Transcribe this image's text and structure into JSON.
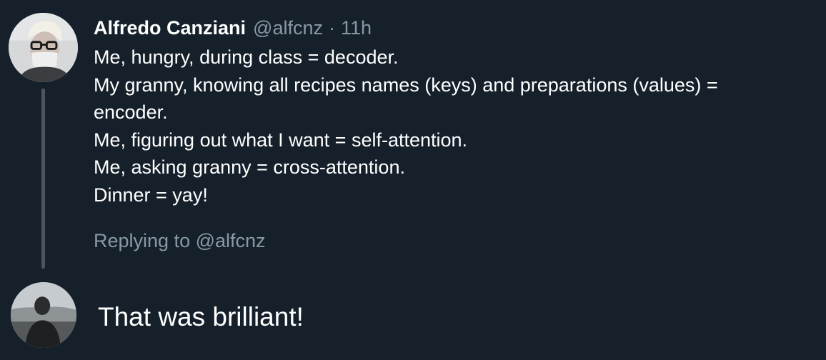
{
  "original_tweet": {
    "author_name": "Alfredo Canziani",
    "author_handle": "@alfcnz",
    "separator": "·",
    "timestamp": "11h",
    "lines": [
      "Me, hungry, during class = decoder.",
      "My granny, knowing all recipes names (keys) and preparations (values) =",
      "encoder.",
      "Me, figuring out what I want = self-attention.",
      "Me, asking granny = cross-attention.",
      "Dinner = yay!"
    ]
  },
  "reply_composer": {
    "replying_label": "Replying to",
    "replying_handle": "@alfcnz",
    "reply_text": "That was brilliant!"
  },
  "colors": {
    "background": "#15202b",
    "primary_text": "#ffffff",
    "secondary_text": "#8899a6",
    "thread_line": "#4a5560"
  },
  "icons": {
    "author_avatar": "author-avatar",
    "user_avatar": "user-avatar"
  }
}
